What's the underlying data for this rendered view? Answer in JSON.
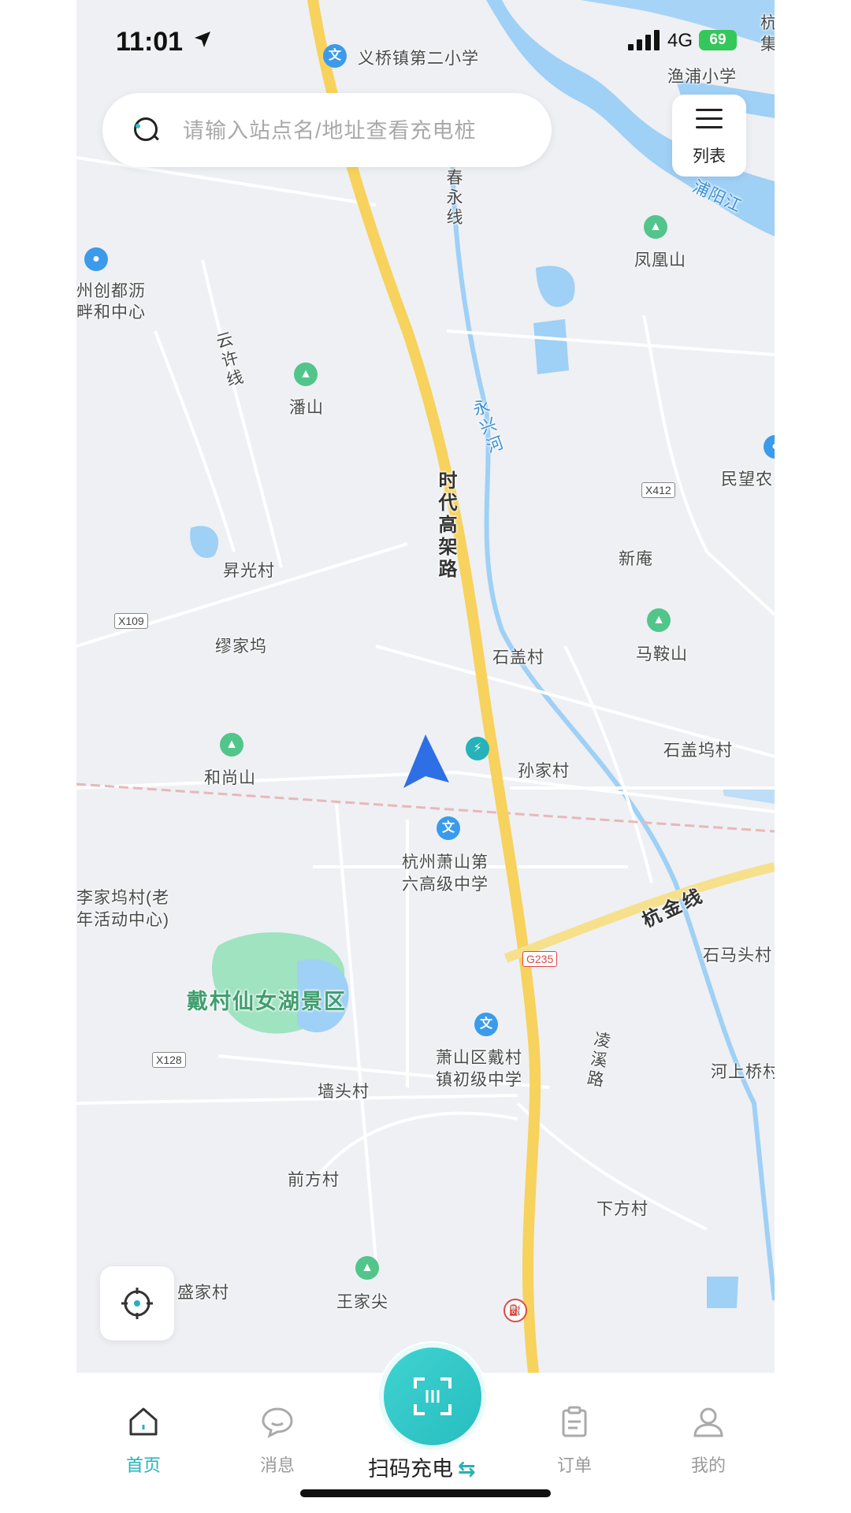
{
  "status_bar": {
    "time": "11:01",
    "carrier": "4G",
    "battery": "69"
  },
  "search": {
    "placeholder": "请输入站点名/地址查看充电桩"
  },
  "list_button": {
    "label": "列表"
  },
  "map_labels": {
    "yiqiao_school": "义桥镇第二小学",
    "yupu_school": "渔浦小学",
    "hang": "杭",
    "ji": "集",
    "puyang_river": "浦阳江",
    "chunyong_line": "春永线",
    "fenghuang_shan": "凤凰山",
    "chuangdu_1": "州创都沥",
    "chuangdu_2": "畔和中心",
    "yunxu_line": "云许线",
    "pan_shan": "潘山",
    "yongxing_river": "永兴河",
    "minwang": "民望农",
    "x412": "X412",
    "shidai_road": "时代高架路",
    "shengguang": "昇光村",
    "xinan": "新庵",
    "x109": "X109",
    "miaojiawu": "缪家坞",
    "mashan": "马鞍山",
    "shigai": "石盖村",
    "heshangshan": "和尚山",
    "shigaiwu": "石盖坞村",
    "sunjia": "孙家村",
    "school6_1": "杭州萧山第",
    "school6_2": "六高级中学",
    "lijiawu_1": "李家坞村(老",
    "lijiawu_2": "年活动中心)",
    "hangjin_line": "杭金线",
    "g235": "G235",
    "shimatou": "石马头村",
    "fairy_lake": "戴村仙女湖景区",
    "daicun_school_1": "萧山区戴村",
    "daicun_school_2": "镇初级中学",
    "lingxi_road": "凌溪路",
    "x128": "X128",
    "qiangtou": "墙头村",
    "heshangqiao": "河上桥村",
    "qianfang": "前方村",
    "xiafang": "下方村",
    "shengjia": "盛家村",
    "wangjiajian": "王家尖"
  },
  "tabs": {
    "home": "首页",
    "messages": "消息",
    "scan": "扫码充电",
    "orders": "订单",
    "mine": "我的"
  },
  "colors": {
    "accent": "#26b2b8",
    "highway": "#f7d25c",
    "water": "#9fd0f6",
    "park": "#9fe3c0"
  }
}
